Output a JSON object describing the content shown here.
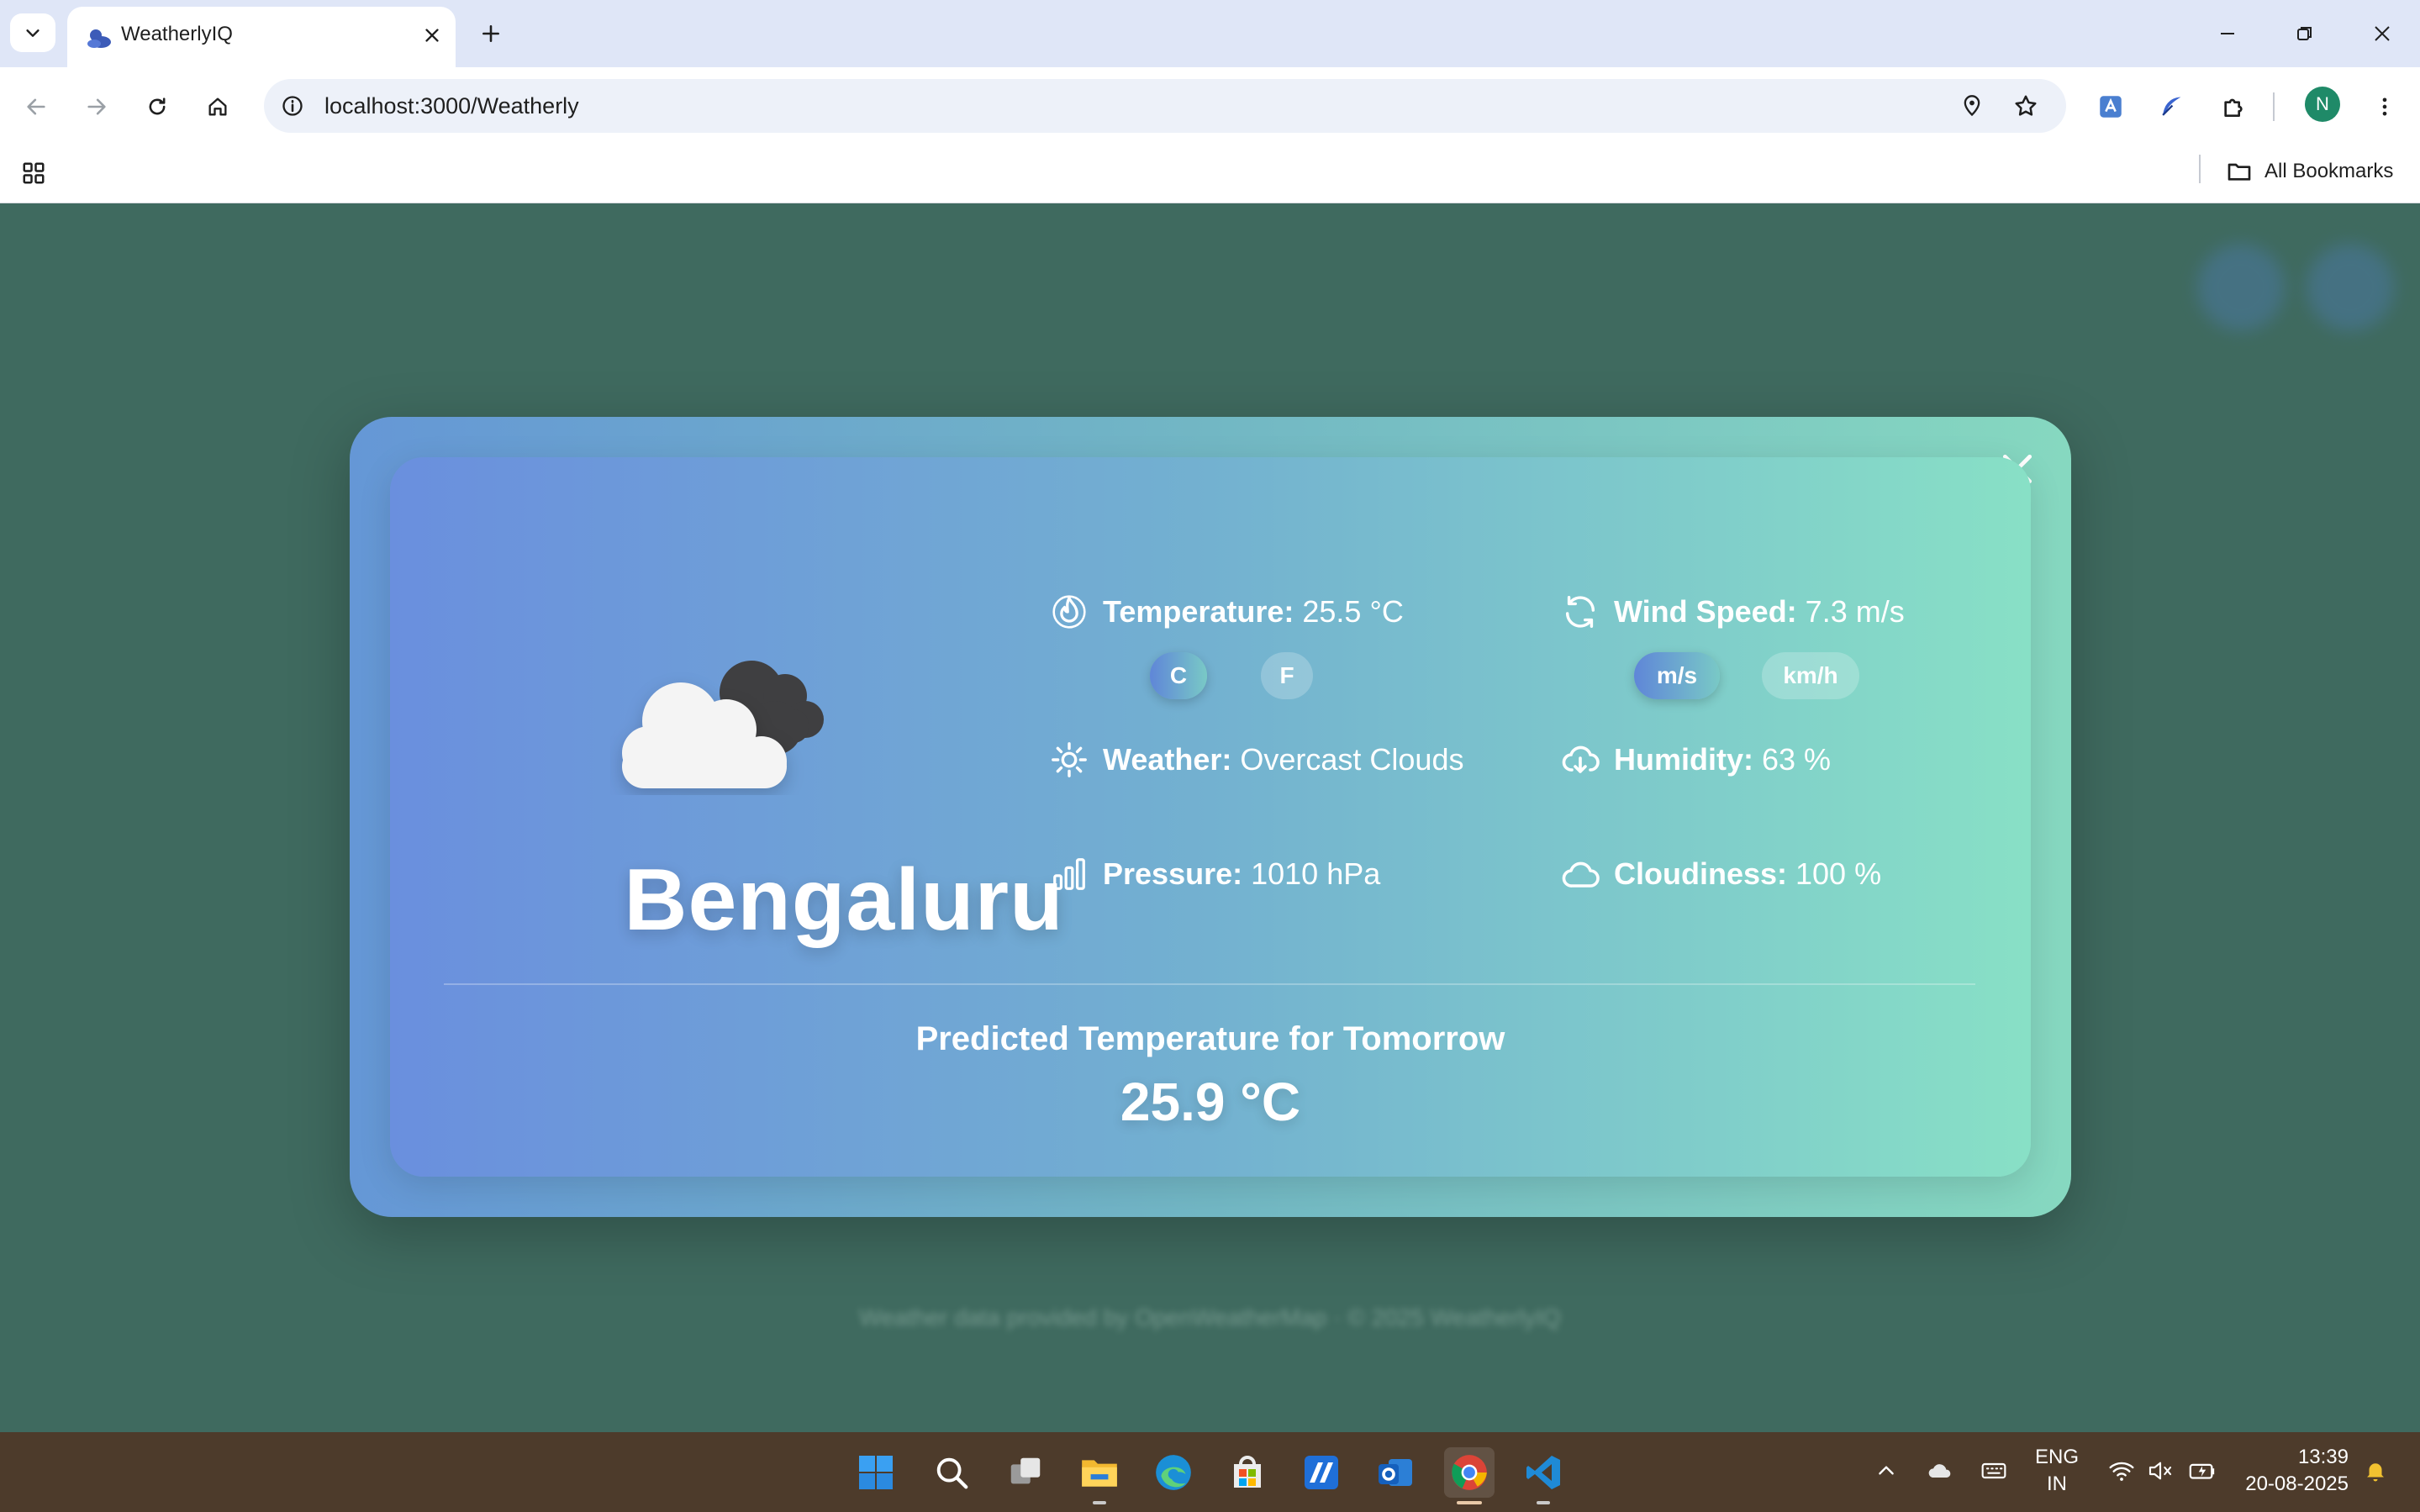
{
  "browser": {
    "tab_title": "WeatherlyIQ",
    "url": "localhost:3000/Weatherly",
    "profile_initial": "N",
    "all_bookmarks_label": "All Bookmarks"
  },
  "page": {
    "footer_text": "Weather data provided by OpenWeatherMap · © 2025 WeatherlyIQ"
  },
  "modal": {
    "city": "Bengaluru",
    "icon": "overcast-clouds-icon",
    "temperature": {
      "label": "Temperature:",
      "value": "25.5 °C",
      "units": [
        "C",
        "F"
      ],
      "selected_unit": "C"
    },
    "wind": {
      "label": "Wind Speed:",
      "value": "7.3 m/s",
      "units": [
        "m/s",
        "km/h"
      ],
      "selected_unit": "m/s"
    },
    "weather": {
      "label": "Weather:",
      "value": "Overcast Clouds"
    },
    "humidity": {
      "label": "Humidity:",
      "value": "63 %"
    },
    "pressure": {
      "label": "Pressure:",
      "value": "1010 hPa"
    },
    "cloudiness": {
      "label": "Cloudiness:",
      "value": "100 %"
    },
    "prediction": {
      "title": "Predicted Temperature for Tomorrow",
      "value": "25.9 °C"
    }
  },
  "taskbar": {
    "language_top": "ENG",
    "language_bottom": "IN",
    "time": "13:39",
    "date": "20-08-2025"
  },
  "colors": {
    "page_bg": "#3f6a5f",
    "modal_gradient_start": "#6a8fde",
    "modal_gradient_end": "#88e0c6",
    "taskbar_bg": "#4d3b2b"
  }
}
